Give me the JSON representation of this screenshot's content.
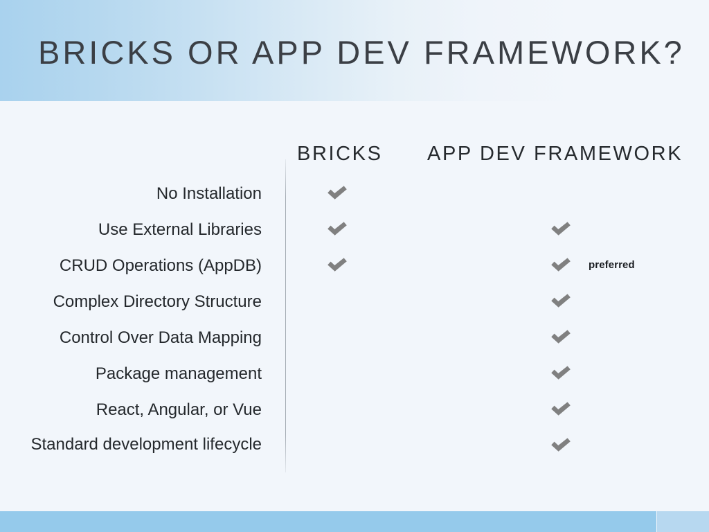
{
  "slide": {
    "title": "BRICKS OR APP DEV FRAMEWORK?",
    "background_color": "#f2f6fb",
    "header_gradient_from": "#a9d2ee",
    "header_gradient_to": "#f2f6fb",
    "footer_color": "#95caeb",
    "footer_accent_color": "#b7d8f0",
    "check_color": "#808080"
  },
  "columns": {
    "bricks_label": "BRICKS",
    "appdev_label": "APP DEV FRAMEWORK"
  },
  "rows": [
    {
      "label": "No Installation",
      "bricks": true,
      "appdev": false,
      "note": ""
    },
    {
      "label": "Use External Libraries",
      "bricks": true,
      "appdev": true,
      "note": ""
    },
    {
      "label": "CRUD Operations (AppDB)",
      "bricks": true,
      "appdev": true,
      "note": "preferred"
    },
    {
      "label": "Complex Directory Structure",
      "bricks": false,
      "appdev": true,
      "note": ""
    },
    {
      "label": "Control Over Data Mapping",
      "bricks": false,
      "appdev": true,
      "note": ""
    },
    {
      "label": "Package management",
      "bricks": false,
      "appdev": true,
      "note": ""
    },
    {
      "label": "React, Angular, or Vue",
      "bricks": false,
      "appdev": true,
      "note": ""
    },
    {
      "label": "Standard development lifecycle",
      "bricks": false,
      "appdev": true,
      "note": ""
    }
  ]
}
